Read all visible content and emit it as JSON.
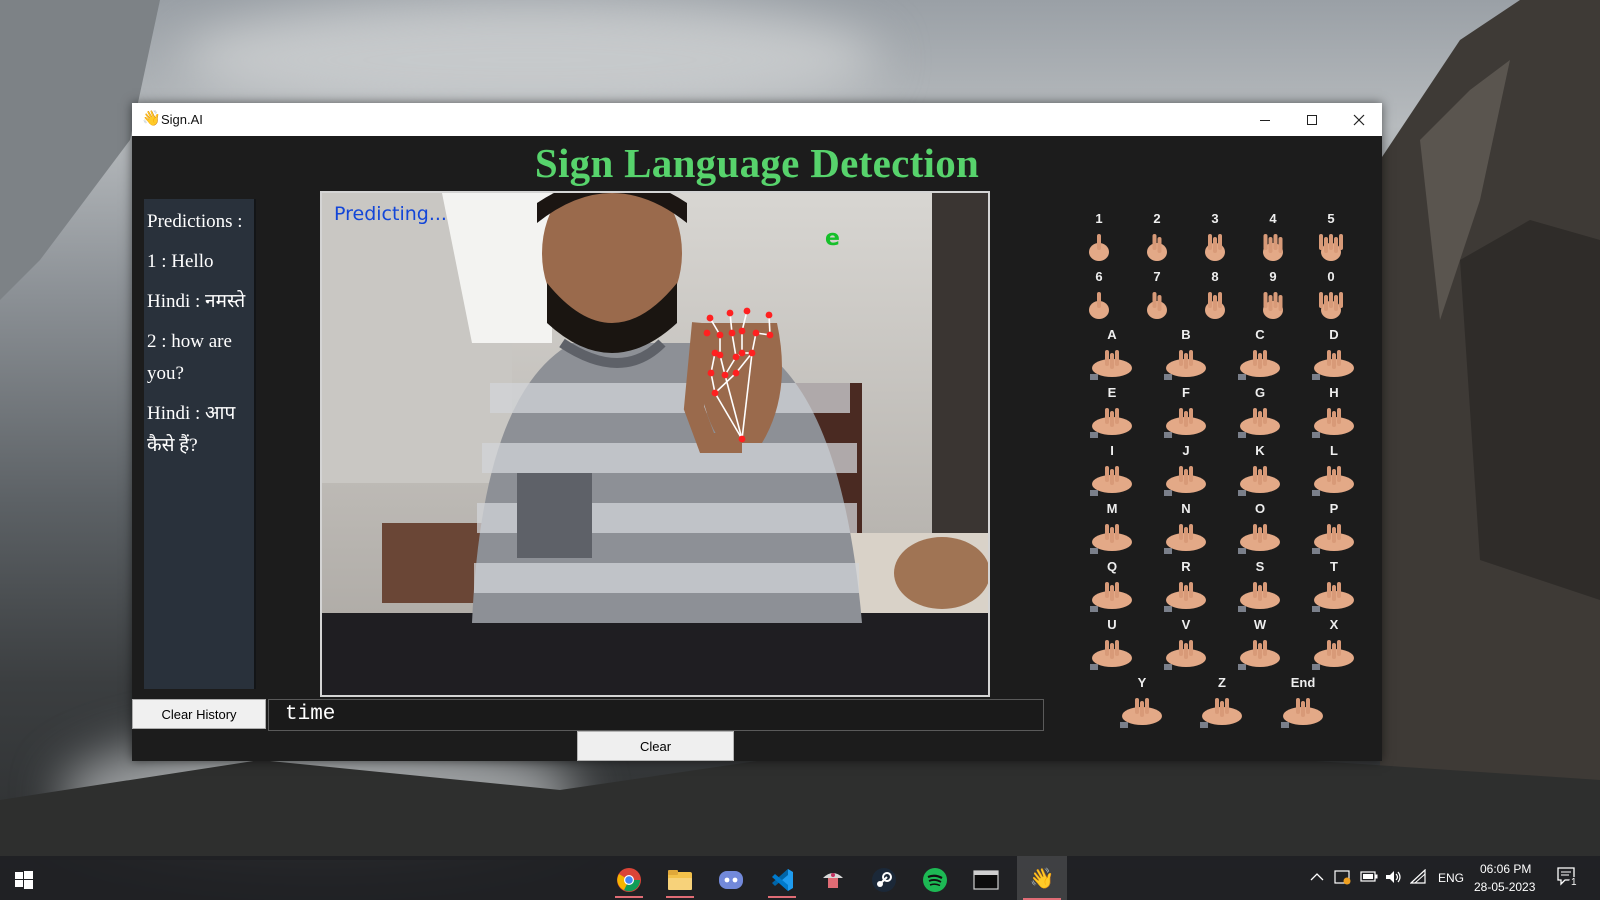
{
  "window": {
    "title": "Sign.AI",
    "controls": [
      "minimize",
      "maximize",
      "close"
    ]
  },
  "heading": "Sign Language Detection",
  "predictions": {
    "header": "Predictions :",
    "items": [
      {
        "english": "1 :  Hello",
        "hindi": "Hindi : नमस्ते"
      },
      {
        "english": "2 :  how are you?",
        "hindi": "Hindi : आप कैसे हैं?"
      }
    ]
  },
  "camera": {
    "status_text": "Predicting...",
    "overlay_char": "e"
  },
  "sign_chart": {
    "labels": [
      "1",
      "2",
      "3",
      "4",
      "5",
      "6",
      "7",
      "8",
      "9",
      "0",
      "A",
      "B",
      "C",
      "D",
      "E",
      "F",
      "G",
      "H",
      "I",
      "J",
      "K",
      "L",
      "M",
      "N",
      "O",
      "P",
      "Q",
      "R",
      "S",
      "T",
      "U",
      "V",
      "W",
      "X",
      "Y",
      "Z",
      "End"
    ]
  },
  "controls": {
    "clear_history_label": "Clear History",
    "text_value": "time",
    "clear_label": "Clear"
  },
  "taskbar": {
    "apps": [
      "chrome-icon",
      "file-explorer-icon",
      "discord-icon",
      "vscode-icon",
      "cheese-icon",
      "steam-icon",
      "spotify-icon",
      "terminal-icon",
      "sign-ai-icon"
    ],
    "language": "ENG",
    "time": "06:06 PM",
    "date": "28-05-2023",
    "notifications": "1"
  },
  "colors": {
    "heading": "#57d36c",
    "panel": "#29313b",
    "window_bg": "#1c1c1c",
    "landmark": "#ff2020"
  }
}
